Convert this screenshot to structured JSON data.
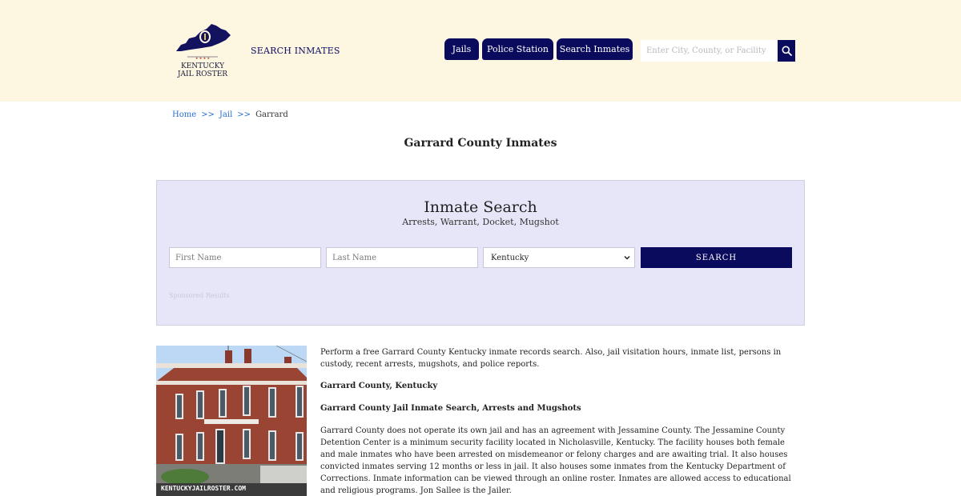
{
  "header": {
    "logo_line1": "KENTUCKY",
    "logo_line2": "JAIL ROSTER",
    "top_link": "SEARCH INMATES",
    "nav": {
      "jails": "Jails",
      "police": "Police Station",
      "search": "Search Inmates"
    },
    "search_placeholder": "Enter City, County, or Facility"
  },
  "breadcrumb": {
    "home": "Home",
    "sep1": ">>",
    "jail": "Jail",
    "sep2": ">>",
    "current": "Garrard"
  },
  "page_title": "Garrard County Inmates",
  "search_panel": {
    "title": "Inmate Search",
    "subtitle": "Arrests, Warrant, Docket, Mugshot",
    "first_name_placeholder": "First Name",
    "last_name_placeholder": "Last Name",
    "state_selected": "Kentucky",
    "button": "SEARCH",
    "sponsored": "Sponsored Results"
  },
  "photo": {
    "watermark": "KENTUCKYJAILROSTER.COM"
  },
  "content": {
    "intro": "Perform a free Garrard County Kentucky inmate records search. Also, jail visitation hours, inmate list, persons in custody, recent arrests, mugshots, and police reports.",
    "heading1": "Garrard County, Kentucky",
    "heading2": "Garrard County Jail Inmate Search, Arrests and Mugshots",
    "body": "Garrard County does not operate its own jail and has an agreement with Jessamine County. The Jessamine County Detention Center is a minimum security facility located in Nicholasville, Kentucky. The facility houses both female and male inmates who have been arrested on misdemeanor or felony charges and are awaiting trial. It also houses convicted inmates serving 12 months or less in jail. It also houses some inmates from the Kentucky Department of Corrections. Inmate information can be viewed through an online roster. Inmates are allowed access to educational and religious programs. Jon Sallee is the Jailer."
  },
  "colors": {
    "navy": "#0b0b5e",
    "header_bg": "#fdf7e2",
    "panel_bg": "#e6e6f8",
    "link": "#2a6fd0"
  }
}
